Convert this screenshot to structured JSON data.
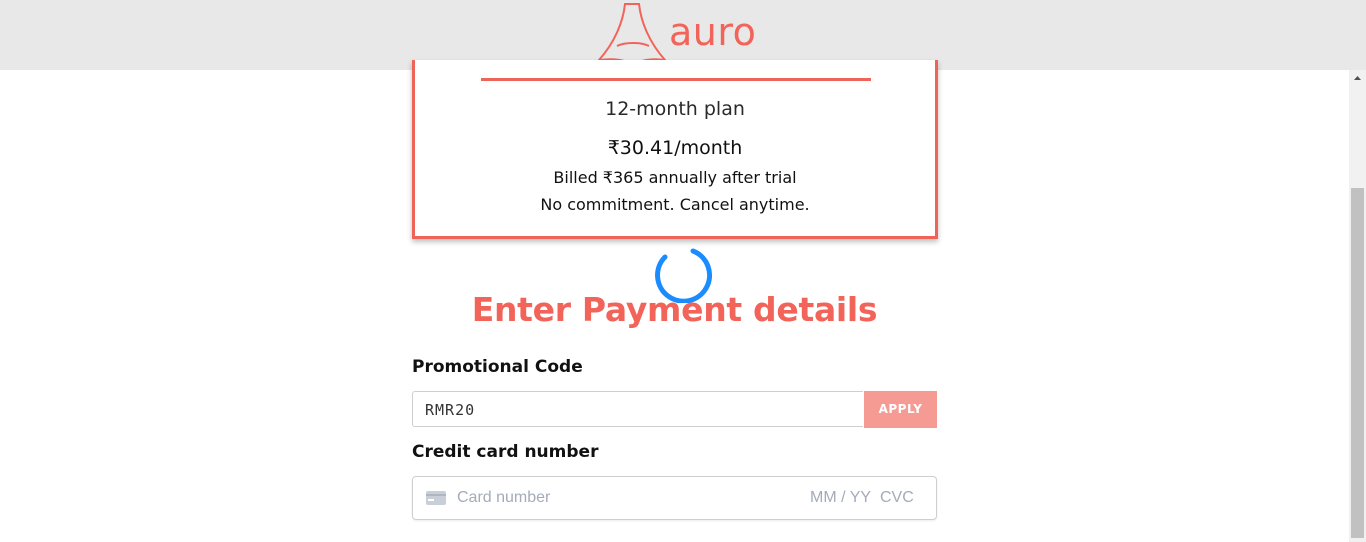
{
  "header": {
    "brand": "auro",
    "brand_color": "#f26459"
  },
  "plan": {
    "name": "12-month plan",
    "price": "₹30.41/month",
    "billed": "Billed ₹365 annually after trial",
    "commitment": "No commitment. Cancel anytime."
  },
  "page": {
    "title": "Enter Payment details"
  },
  "promo": {
    "label": "Promotional Code",
    "value": "RMR20",
    "apply_label": "APPLY"
  },
  "card": {
    "label": "Credit card number",
    "placeholder": "Card number",
    "expiry_placeholder": "MM / YY",
    "cvc_placeholder": "CVC",
    "icon": "credit-card-icon"
  },
  "colors": {
    "accent": "#f26459",
    "apply_button": "#f59b93",
    "spinner": "#1a8cff"
  }
}
